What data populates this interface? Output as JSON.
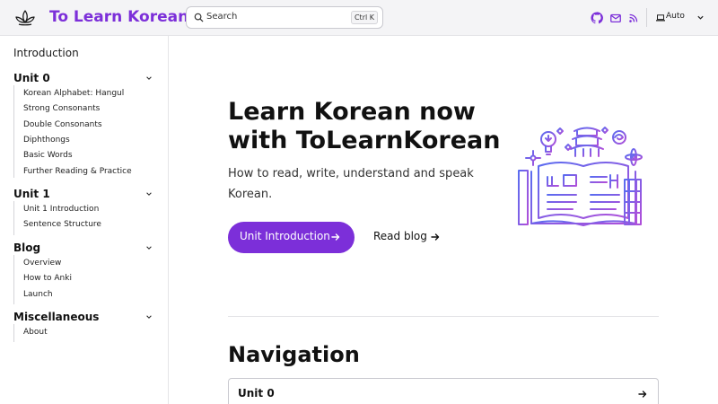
{
  "header": {
    "brand": "To Learn Korean",
    "search_placeholder": "Search",
    "search_shortcut": "Ctrl K",
    "theme_label": "Auto"
  },
  "sidebar": {
    "intro": "Introduction",
    "groups": [
      {
        "title": "Unit 0",
        "items": [
          "Korean Alphabet: Hangul",
          "Strong Consonants",
          "Double Consonants",
          "Diphthongs",
          "Basic Words",
          "Further Reading & Practice"
        ]
      },
      {
        "title": "Unit 1",
        "items": [
          "Unit 1 Introduction",
          "Sentence Structure"
        ]
      },
      {
        "title": "Blog",
        "items": [
          "Overview",
          "How to Anki",
          "Launch"
        ]
      },
      {
        "title": "Miscellaneous",
        "items": [
          "About"
        ]
      }
    ]
  },
  "hero": {
    "title": "Learn Korean now with ToLearnKorean",
    "subtitle": "How to read, write, understand and speak Korean.",
    "primary_button": "Unit Introduction",
    "secondary_button": "Read blog"
  },
  "navigation": {
    "title": "Navigation",
    "cards": [
      "Unit 0"
    ]
  },
  "colors": {
    "accent": "#7c2fd9",
    "art_gradient_start": "#5a6cf0",
    "art_gradient_end": "#b04fd9"
  }
}
